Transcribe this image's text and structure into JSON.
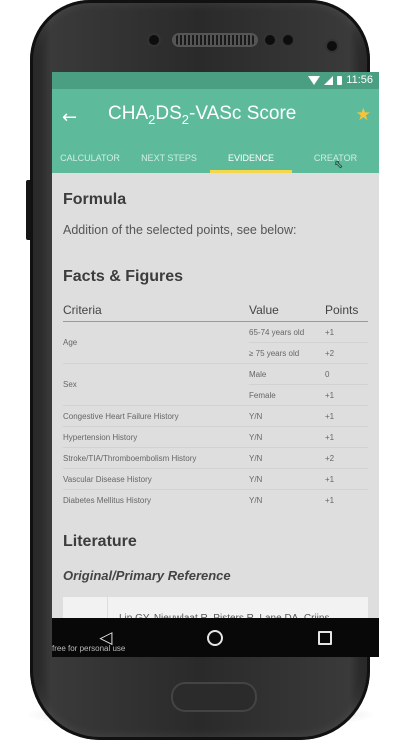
{
  "status_bar": {
    "time": "11:56"
  },
  "app_bar": {
    "title_main": "CHA",
    "title_sub1": "2",
    "title_mid": "DS",
    "title_sub2": "2",
    "title_end": "-VASc Score"
  },
  "tabs": [
    {
      "label": "CALCULATOR"
    },
    {
      "label": "NEXT STEPS"
    },
    {
      "label": "EVIDENCE"
    },
    {
      "label": "CREATOR"
    }
  ],
  "formula": {
    "heading": "Formula",
    "text": "Addition of the selected points, see below:"
  },
  "facts": {
    "heading": "Facts & Figures",
    "headers": [
      "Criteria",
      "Value",
      "Points"
    ],
    "rows": [
      {
        "criteria": "Age",
        "values": [
          {
            "value": "65-74 years old",
            "points": "+1"
          },
          {
            "value": "≥ 75 years old",
            "points": "+2"
          }
        ]
      },
      {
        "criteria": "Sex",
        "values": [
          {
            "value": "Male",
            "points": "0"
          },
          {
            "value": "Female",
            "points": "+1"
          }
        ]
      },
      {
        "criteria": "Congestive Heart Failure History",
        "value": "Y/N",
        "points": "+1"
      },
      {
        "criteria": "Hypertension History",
        "value": "Y/N",
        "points": "+1"
      },
      {
        "criteria": "Stroke/TIA/Thromboembolism History",
        "value": "Y/N",
        "points": "+2"
      },
      {
        "criteria": "Vascular Disease History",
        "value": "Y/N",
        "points": "+1"
      },
      {
        "criteria": "Diabetes Mellitus History",
        "value": "Y/N",
        "points": "+1"
      }
    ]
  },
  "literature": {
    "heading": "Literature",
    "subheading": "Original/Primary Reference",
    "reference_snippet": "Lip GY, Nieuwlaat R, Pisters R, Lane DA, Crijns"
  },
  "watermark": "free for personal use",
  "colors": {
    "status_bar": "#4a9e82",
    "app_bar": "#5dbb9c",
    "tab_indicator": "#f4d84c",
    "star": "#f7c439"
  },
  "icons": [
    "back-arrow-icon",
    "star-icon",
    "wifi-icon",
    "signal-icon",
    "battery-icon",
    "nav-back-icon",
    "nav-home-icon",
    "nav-recents-icon"
  ]
}
